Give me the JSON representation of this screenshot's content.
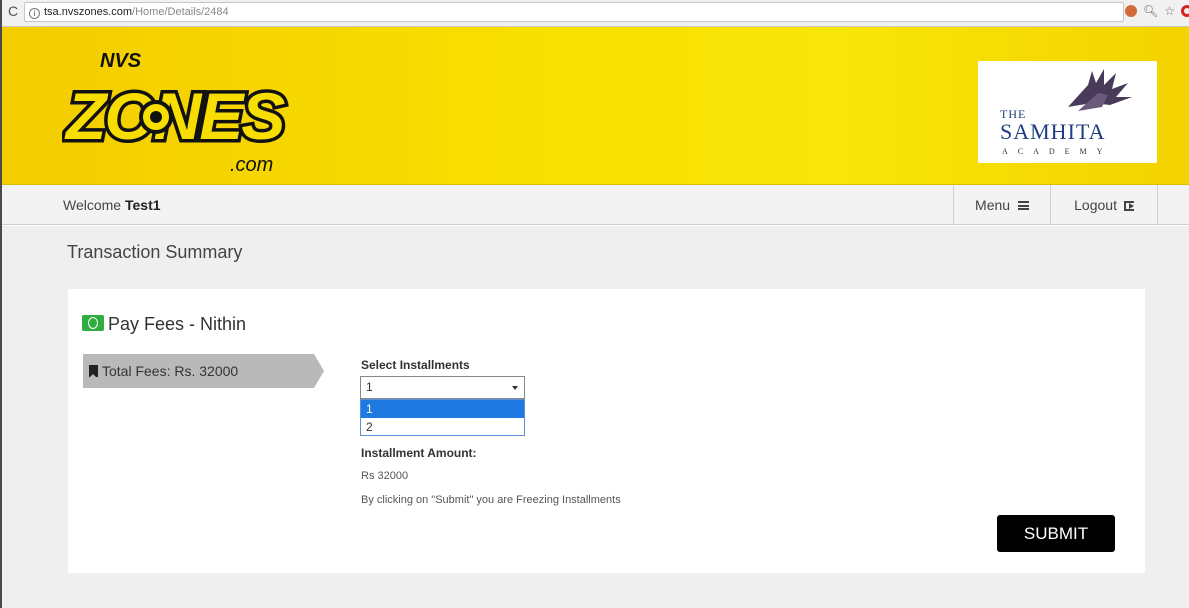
{
  "browser": {
    "url_host": "tsa.nvszones.com",
    "url_path": "/Home/Details/2484",
    "icons": [
      "reload-icon",
      "info-icon",
      "extension-icon",
      "zoom-icon",
      "star-icon",
      "opera-icon"
    ]
  },
  "header": {
    "logo": {
      "top": "NVS",
      "main": "ZONES",
      "suffix": ".com"
    },
    "academy": {
      "the": "THE",
      "name": "SAMHITA",
      "sub": "ACADEMY"
    }
  },
  "nav": {
    "welcome_prefix": "Welcome",
    "username": "Test1",
    "menu_label": "Menu",
    "logout_label": "Logout"
  },
  "main": {
    "page_title": "Transaction Summary",
    "card": {
      "title": "Pay Fees - Nithin",
      "total_fees": "Total Fees: Rs. 32000",
      "select_label": "Select Installments",
      "selected_value": "1",
      "options": [
        "1",
        "2"
      ],
      "amount_label": "Installment Amount:",
      "amount_value": "Rs 32000",
      "notice": "By clicking on \"Submit\" you are Freezing Installments",
      "submit_label": "SUBMIT"
    }
  },
  "colors": {
    "header_yellow": "#f7de00",
    "dropdown_highlight": "#1e7ae0",
    "money_icon": "#2fae3f",
    "submit_bg": "#000000"
  }
}
